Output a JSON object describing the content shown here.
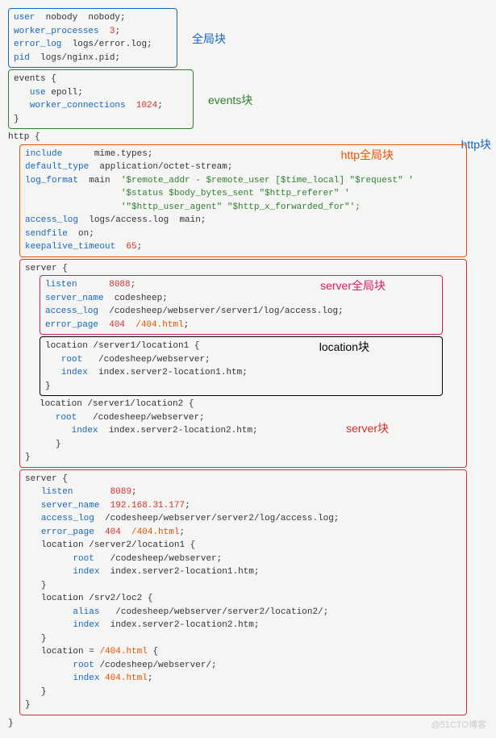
{
  "labels": {
    "global": "全局块",
    "events": "events块",
    "http": "http块",
    "http_global": "http全局块",
    "server_global": "server全局块",
    "location": "location块",
    "server": "server块"
  },
  "global_block": {
    "l1a": "user",
    "l1b": "nobody",
    "l1c": "nobody;",
    "l2a": "worker_processes",
    "l2b": "3",
    "l2c": ";",
    "l3a": "error_log",
    "l3b": "logs/error.log;",
    "l4a": "pid",
    "l4b": "logs/nginx.pid;"
  },
  "events_block": {
    "open": "events {",
    "use": "use",
    "use_v": "epoll;",
    "wc": "worker_connections",
    "wc_v": "1024",
    "sc": ";",
    "close": "}"
  },
  "http_open": "http {",
  "http_close": "}",
  "http_global": {
    "inc": "include",
    "inc_v": "mime.types;",
    "def": "default_type",
    "def_v": "application/octet-stream;",
    "lf": "log_format",
    "lf_n": "main",
    "lf1": "'$remote_addr - $remote_user [$time_local] \"$request\" '",
    "lf2": "'$status $body_bytes_sent \"$http_referer\" '",
    "lf3": "'\"$http_user_agent\" \"$http_x_forwarded_for\"';",
    "al": "access_log",
    "al_v": "logs/access.log",
    "al_m": "main;",
    "sf": "sendfile",
    "sf_v": "on;",
    "kt": "keepalive_timeout",
    "kt_v": "65",
    "sc": ";"
  },
  "server1": {
    "open": "server {",
    "close": "}",
    "global": {
      "lst": "listen",
      "lst_v": "8088",
      "sc": ";",
      "sn": "server_name",
      "sn_v": "codesheep;",
      "al": "access_log",
      "al_v": "/codesheep/webserver/server1/log/access.log;",
      "ep": "error_page",
      "ep_c": "404",
      "ep_v": "/404.html",
      "sc2": ";"
    },
    "loc1": {
      "open": "location /server1/location1 {",
      "root": "root",
      "root_v": "/codesheep/webserver;",
      "idx": "index",
      "idx_v": "index.server2-location1.htm;",
      "close": "}"
    },
    "loc2": {
      "open": "location /server1/location2 {",
      "root": "root",
      "root_v": "/codesheep/webserver;",
      "idx": "index",
      "idx_v": "index.server2-location2.htm;",
      "close": "}"
    }
  },
  "server2": {
    "open": "server {",
    "close": "}",
    "lst": "listen",
    "lst_v": "8089",
    "sc": ";",
    "sn": "server_name",
    "sn_v": "192.168.31.177",
    "sc2": ";",
    "al": "access_log",
    "al_v": "/codesheep/webserver/server2/log/access.log;",
    "ep": "error_page",
    "ep_c": "404",
    "ep_v": "/404.html",
    "sc3": ";",
    "loc1": {
      "open": "location /server2/location1 {",
      "root": "root",
      "root_v": "/codesheep/webserver;",
      "idx": "index",
      "idx_v": "index.server2-location1.htm;",
      "close": "}"
    },
    "loc2": {
      "open": "location /srv2/loc2 {",
      "alias": "alias",
      "alias_v": "/codesheep/webserver/server2/location2/;",
      "idx": "index",
      "idx_v": "index.server2-location2.htm;",
      "close": "}"
    },
    "loc3": {
      "open_a": "location = ",
      "open_b": "/404.html",
      "open_c": " {",
      "root": "root",
      "root_v": "/codesheep/webserver/;",
      "idx": "index",
      "idx_v": "404.html",
      "sc": ";",
      "close": "}"
    }
  },
  "watermark": "@51CTO博客"
}
